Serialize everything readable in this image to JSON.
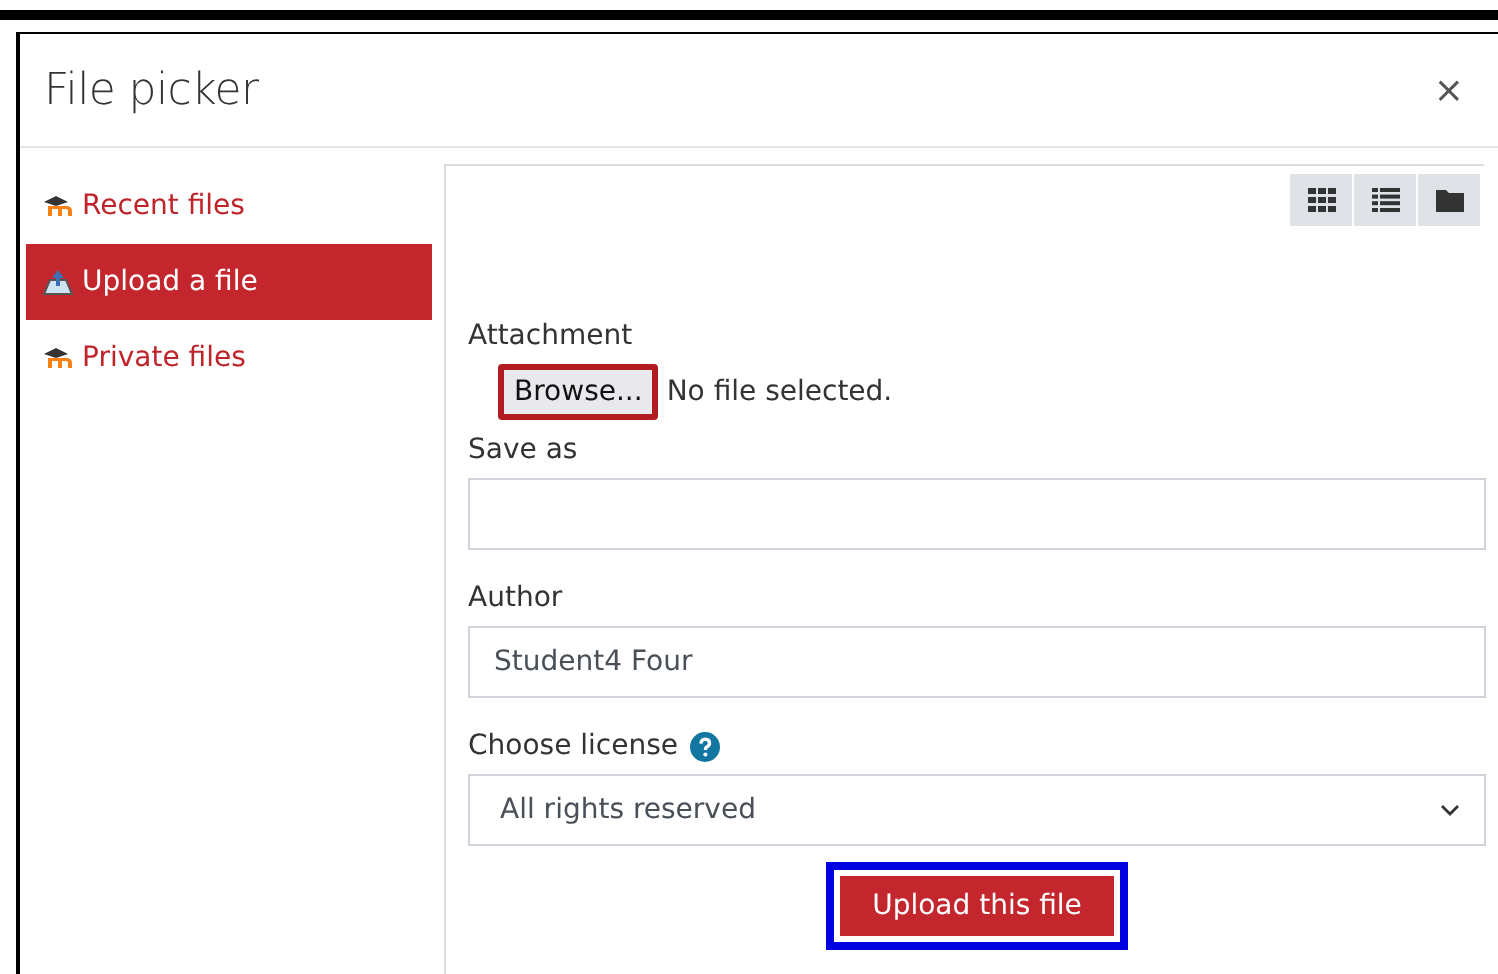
{
  "window": {
    "title": "File picker",
    "close": "×"
  },
  "sidebar": {
    "items": [
      {
        "label": "Recent files",
        "kind": "repository",
        "selected": false
      },
      {
        "label": "Upload a file",
        "kind": "upload",
        "selected": true
      },
      {
        "label": "Private files",
        "kind": "repository",
        "selected": false
      }
    ]
  },
  "view_buttons": [
    {
      "kind": "grid"
    },
    {
      "kind": "list"
    },
    {
      "kind": "folder"
    }
  ],
  "form": {
    "attachment": {
      "label": "Attachment",
      "button": "Browse...",
      "button_highlighted": true,
      "status": "No file selected."
    },
    "save_as": {
      "label": "Save as"
    },
    "author": {
      "label": "Author",
      "value": "Student4 Four"
    },
    "license": {
      "label": "Choose license",
      "value": "All rights reserved"
    },
    "submit": {
      "label": "Upload this file",
      "highlighted": true
    }
  }
}
